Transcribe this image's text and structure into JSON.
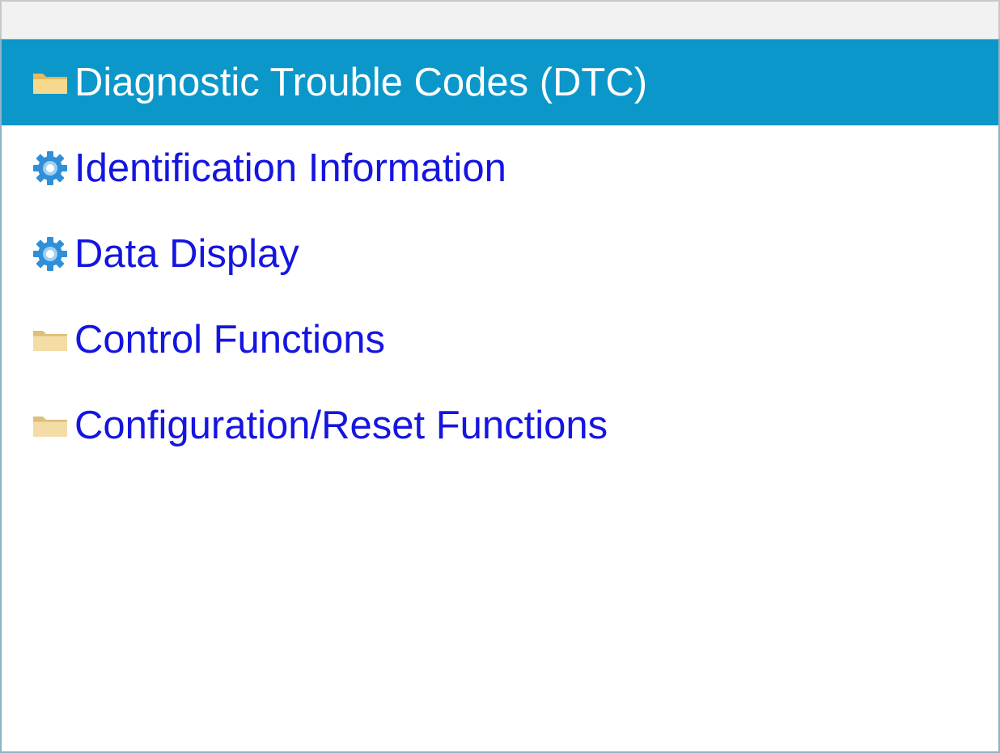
{
  "menu": {
    "items": [
      {
        "label": "Diagnostic Trouble Codes (DTC)",
        "icon": "folder-icon",
        "selected": true
      },
      {
        "label": "Identification Information",
        "icon": "gear-icon",
        "selected": false
      },
      {
        "label": "Data Display",
        "icon": "gear-icon",
        "selected": false
      },
      {
        "label": "Control Functions",
        "icon": "folder-icon",
        "selected": false
      },
      {
        "label": "Configuration/Reset Functions",
        "icon": "folder-icon",
        "selected": false
      }
    ]
  },
  "colors": {
    "selected_background": "#0b97c9",
    "item_text": "#1515e0",
    "selected_text": "#ffffff",
    "folder": "#f3d58b",
    "gear": "#2f8fd8"
  }
}
